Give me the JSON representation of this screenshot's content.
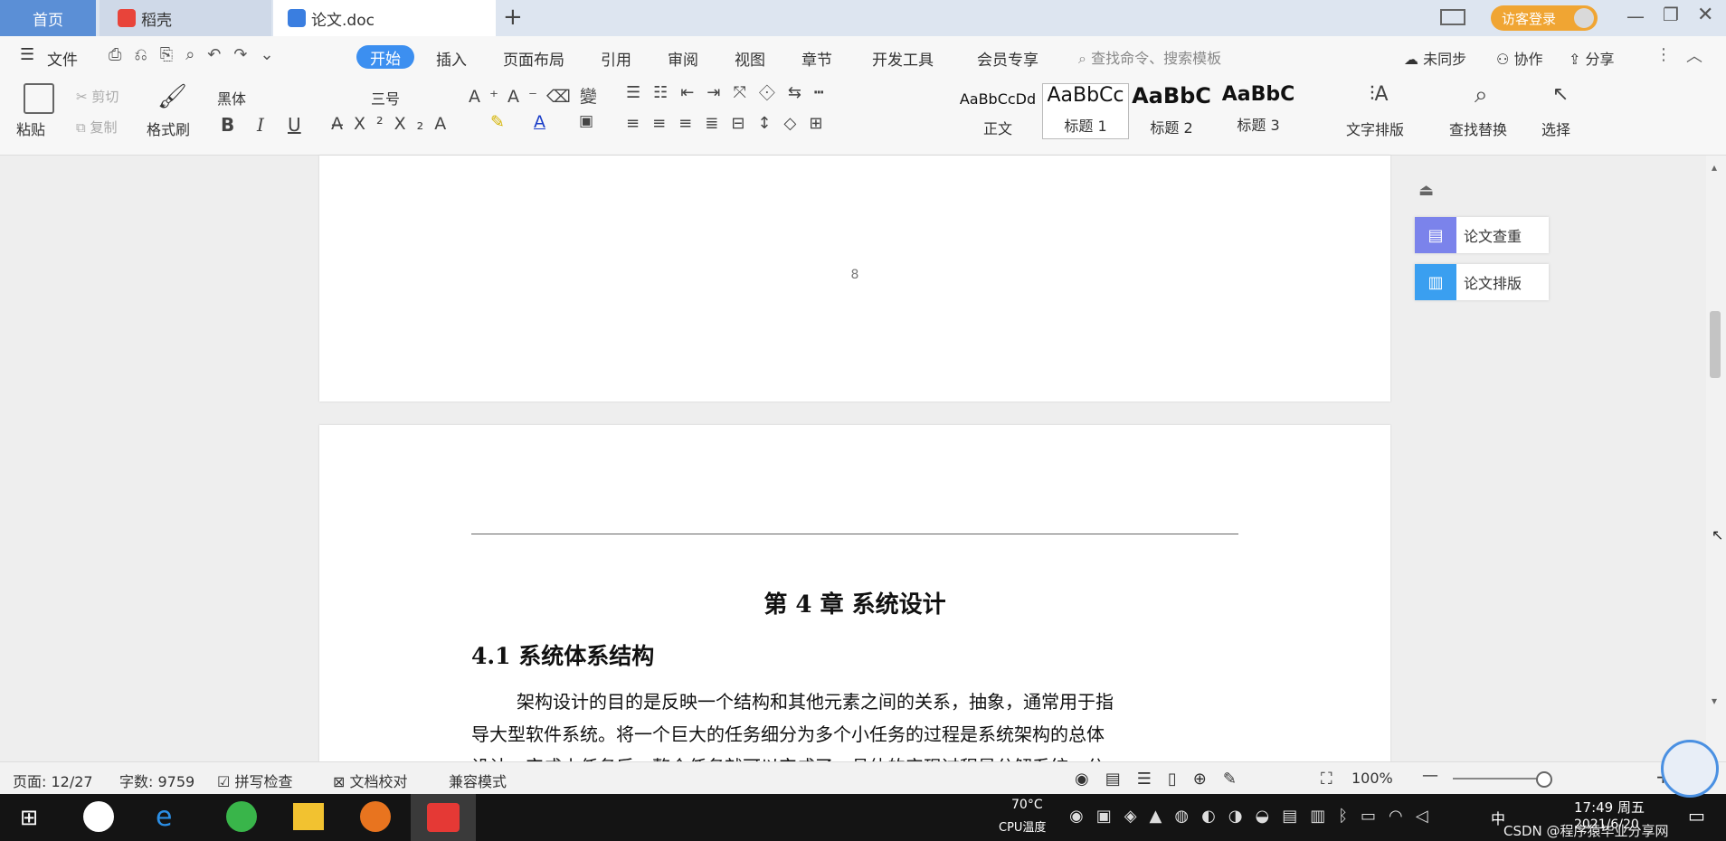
{
  "tabs": {
    "home": "首页",
    "daoke": "稻壳",
    "doc": "论文.doc",
    "new_tab": "+"
  },
  "titlebar": {
    "login": "访客登录"
  },
  "menu": {
    "file": "文件",
    "items": [
      "开始",
      "插入",
      "页面布局",
      "引用",
      "审阅",
      "视图",
      "章节",
      "开发工具",
      "会员专享"
    ],
    "search_placeholder": "查找命令、搜索模板",
    "sync": "未同步",
    "collab": "协作",
    "share": "分享"
  },
  "ribbon": {
    "paste": "粘贴",
    "cut": "剪切",
    "copy": "复制",
    "format_painter": "格式刷",
    "font_name": "黑体",
    "font_size": "三号",
    "styles": [
      {
        "preview": "AaBbCcDd",
        "name": "正文"
      },
      {
        "preview": "AaBbCc",
        "name": "标题 1"
      },
      {
        "preview": "AaBbC",
        "name": "标题 2"
      },
      {
        "preview": "AaBbC",
        "name": "标题 3"
      }
    ],
    "text_layout": "文字排版",
    "find_replace": "查找替换",
    "select": "选择"
  },
  "document": {
    "page_number": "8",
    "chapter_title": "第 4 章  系统设计",
    "section_title": "4.1  系统体系结构",
    "para_line1": "架构设计的目的是反映一个结构和其他元素之间的关系，抽象，通常用于指",
    "para_line2": "导大型软件系统。将一个巨大的任务细分为多个小任务的过程是系统架构的总体",
    "para_line3": "设计，完成小任务后，整个任务就可以完成了。具体的实现过程是分解系统，分"
  },
  "side_panel": {
    "check": "论文查重",
    "layout": "论文排版"
  },
  "status": {
    "page": "页面: 12/27",
    "words": "字数: 9759",
    "spell": "拼写检查",
    "proof": "文档校对",
    "compat": "兼容模式",
    "zoom": "100%"
  },
  "taskbar": {
    "temp": "70°C",
    "cpu": "CPU温度",
    "time": "17:49 周五",
    "date": "2021/6/20",
    "lang": "中",
    "watermark": "CSDN @程序猿毕业分享网"
  }
}
